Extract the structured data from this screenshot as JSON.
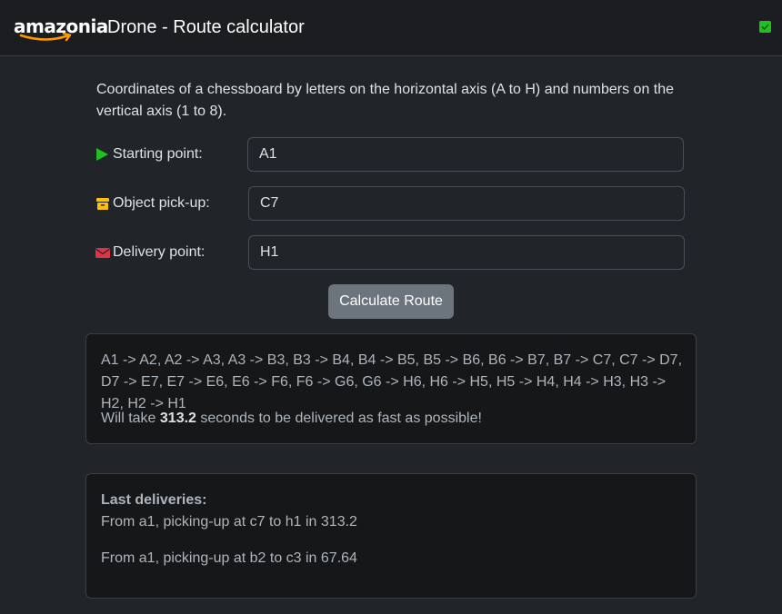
{
  "header": {
    "logo_text": "amazonia",
    "title": "Drone - Route calculator",
    "status_color": "#20c020"
  },
  "intro": {
    "text": "Coordinates of a chessboard by letters on the horizontal axis (A to H) and numbers on the vertical axis (1 to 8)."
  },
  "form": {
    "starting_point": {
      "label": "Starting point:",
      "icon": "play-icon",
      "icon_color": "#20c020",
      "value": "A1"
    },
    "object_pickup": {
      "label": "Object pick-up:",
      "icon": "box-icon",
      "icon_color": "#ffc107",
      "value": "C7"
    },
    "delivery_point": {
      "label": "Delivery point:",
      "icon": "envelope-icon",
      "icon_color": "#dc3545",
      "value": "H1"
    },
    "submit_label": "Calculate Route"
  },
  "result": {
    "route": "A1 -> A2, A2 -> A3, A3 -> B3, B3 -> B4, B4 -> B5, B5 -> B6, B6 -> B7, B7 -> C7, C7 -> D7, D7 -> E7, E7 -> E6, E6 -> F6, F6 -> G6, G6 -> H6, H6 -> H5, H5 -> H4, H4 -> H3, H3 -> H2, H2 -> H1",
    "time_prefix": "Will take",
    "time_value": "313.2",
    "time_suffix": "seconds to be delivered as fast as possible!"
  },
  "last_deliveries": {
    "title": "Last deliveries:",
    "items": [
      "From a1, picking-up at c7 to h1 in 313.2",
      "From a1, picking-up at b2 to c3 in 67.64"
    ]
  }
}
